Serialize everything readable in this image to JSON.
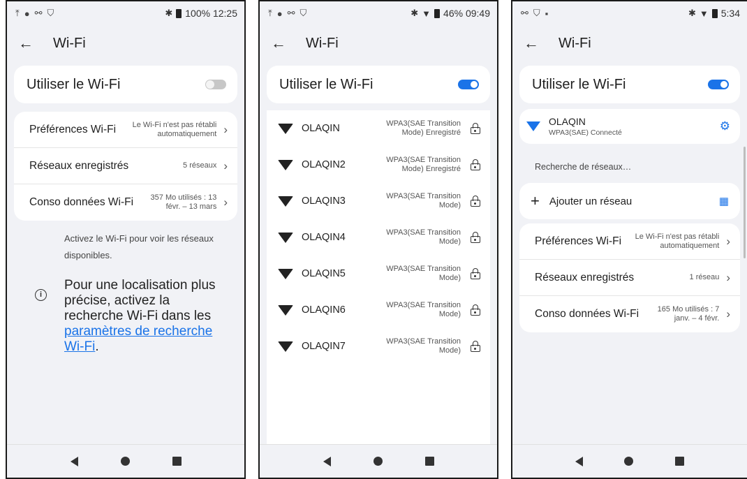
{
  "colors": {
    "accent": "#1a73e8",
    "background": "#f1f2f6",
    "card": "#ffffff"
  },
  "screens": [
    {
      "status": {
        "icons": [
          "upload-icon",
          "dot-icon",
          "link-icon",
          "shield-icon"
        ],
        "right": "100% 12:25"
      },
      "title": "Wi-Fi",
      "toggle_label": "Utiliser le Wi-Fi",
      "wifi_on": false,
      "prefs": [
        {
          "label": "Préférences Wi-Fi",
          "sub": "Le Wi-Fi n'est pas rétabli automatiquement"
        },
        {
          "label": "Réseaux enregistrés",
          "sub": "5 réseaux"
        },
        {
          "label": "Conso données Wi-Fi",
          "sub": "357 Mo utilisés : 13 févr. – 13 mars"
        }
      ],
      "info_small": "Activez le Wi-Fi pour voir les réseaux disponibles.",
      "info_large_text": "Pour une localisation plus précise, activez la recherche Wi-Fi dans les",
      "info_link": "paramètres de recherche Wi-Fi",
      "info_end": "."
    },
    {
      "status": {
        "right": "46% 09:49"
      },
      "title": "Wi-Fi",
      "toggle_label": "Utiliser le Wi-Fi",
      "wifi_on": true,
      "networks": [
        {
          "name": "OLAQIN",
          "security": "WPA3(SAE Transition Mode) Enregistré"
        },
        {
          "name": "OLAQIN2",
          "security": "WPA3(SAE Transition Mode) Enregistré"
        },
        {
          "name": "OLAQIN3",
          "security": "WPA3(SAE Transition Mode)"
        },
        {
          "name": "OLAQIN4",
          "security": "WPA3(SAE Transition Mode)"
        },
        {
          "name": "OLAQIN5",
          "security": "WPA3(SAE Transition Mode)"
        },
        {
          "name": "OLAQIN6",
          "security": "WPA3(SAE Transition Mode)"
        },
        {
          "name": "OLAQIN7",
          "security": "WPA3(SAE Transition Mode)"
        }
      ]
    },
    {
      "status": {
        "right": "5:34"
      },
      "title": "Wi-Fi",
      "toggle_label": "Utiliser le Wi-Fi",
      "wifi_on": true,
      "connected": {
        "name": "OLAQIN",
        "sub": "WPA3(SAE) Connecté"
      },
      "scanning": "Recherche de réseaux…",
      "add_network": "Ajouter un réseau",
      "prefs": [
        {
          "label": "Préférences Wi-Fi",
          "sub": "Le Wi-Fi n'est pas rétabli automatiquement"
        },
        {
          "label": "Réseaux enregistrés",
          "sub": "1 réseau"
        },
        {
          "label": "Conso données Wi-Fi",
          "sub": "165 Mo utilisés : 7 janv. – 4 févr."
        }
      ]
    }
  ]
}
